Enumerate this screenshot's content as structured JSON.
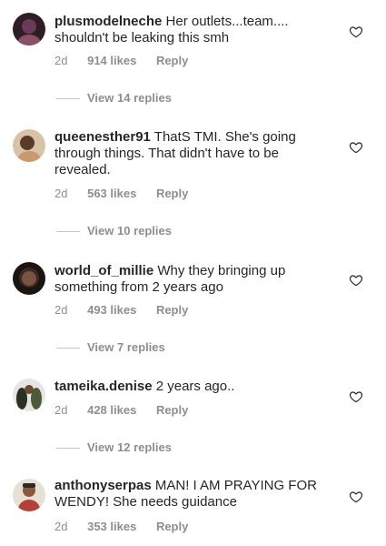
{
  "comments": [
    {
      "username": "plusmodelneche",
      "text": "Her outlets...team.... shouldn't be leaking this smh",
      "time": "2d",
      "likes": "914 likes",
      "reply_label": "Reply",
      "view_replies": "View 14 replies",
      "avatar_colors": [
        "#6b3a5a",
        "#2e1e24"
      ]
    },
    {
      "username": "queenesther91",
      "text": "ThatS TMI. She's going through things. That didn't have to be revealed.",
      "time": "2d",
      "likes": "563 likes",
      "reply_label": "Reply",
      "view_replies": "View 10 replies",
      "avatar_colors": [
        "#c99a6b",
        "#5a3b2a"
      ]
    },
    {
      "username": "world_of_millie",
      "text": "Why they bringing up something from 2 years ago",
      "time": "2d",
      "likes": "493 likes",
      "reply_label": "Reply",
      "view_replies": "View 7 replies",
      "avatar_colors": [
        "#3a2a22",
        "#1a1412"
      ]
    },
    {
      "username": "tameika.denise",
      "text": "2 years ago..",
      "time": "2d",
      "likes": "428 likes",
      "reply_label": "Reply",
      "view_replies": "View 12 replies",
      "avatar_colors": [
        "#4d5a3a",
        "#2b2f24"
      ]
    },
    {
      "username": "anthonyserpas",
      "text": "MAN! I AM PRAYING FOR WENDY!  She needs guidance",
      "time": "2d",
      "likes": "353 likes",
      "reply_label": "Reply",
      "avatar_colors": [
        "#b2413a",
        "#e8e0d6"
      ]
    }
  ],
  "icons": {
    "like": "heart-outline-icon"
  },
  "colors": {
    "text": "#262626",
    "muted": "#8e8e8e"
  }
}
